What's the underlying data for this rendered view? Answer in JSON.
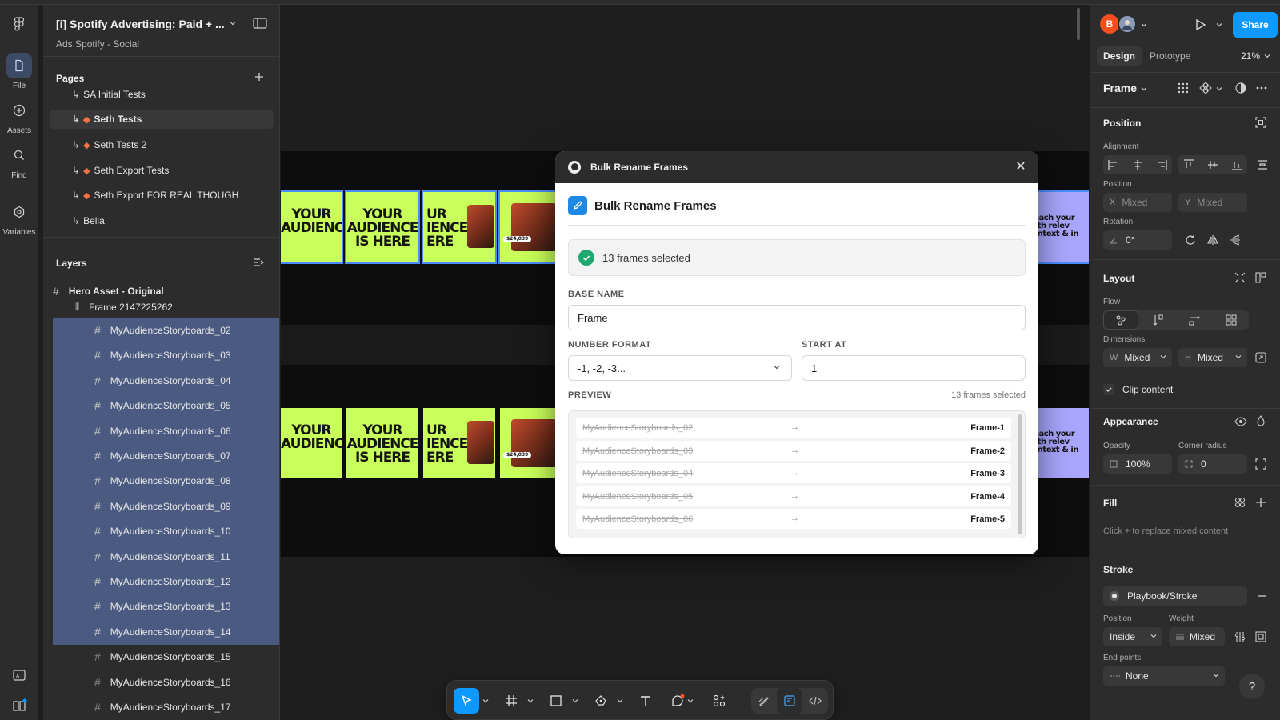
{
  "left_rail": {
    "items": [
      {
        "label": "File",
        "icon": "file-icon"
      },
      {
        "label": "Assets",
        "icon": "assets-icon"
      },
      {
        "label": "Find",
        "icon": "search-icon"
      },
      {
        "label": "Variables",
        "icon": "variables-icon"
      }
    ]
  },
  "file": {
    "title": "[i] Spotify Advertising: Paid + ...",
    "subtitle": "Ads.Spotify - Social"
  },
  "pages": {
    "header": "Pages",
    "items": [
      {
        "label": "SA Initial Tests",
        "emoji": false
      },
      {
        "label": "Seth Tests",
        "emoji": true,
        "selected": true
      },
      {
        "label": "Seth Tests 2",
        "emoji": true
      },
      {
        "label": "Seth Export Tests",
        "emoji": true
      },
      {
        "label": "Seth Export FOR REAL THOUGH",
        "emoji": true
      },
      {
        "label": "Bella",
        "emoji": false
      }
    ]
  },
  "layers": {
    "header": "Layers",
    "root": "Hero Asset - Original",
    "frame": "Frame 2147225262",
    "items": [
      {
        "label": "MyAudienceStoryboards_02",
        "selected": true
      },
      {
        "label": "MyAudienceStoryboards_03",
        "selected": true
      },
      {
        "label": "MyAudienceStoryboards_04",
        "selected": true
      },
      {
        "label": "MyAudienceStoryboards_05",
        "selected": true
      },
      {
        "label": "MyAudienceStoryboards_06",
        "selected": true
      },
      {
        "label": "MyAudienceStoryboards_07",
        "selected": true
      },
      {
        "label": "MyAudienceStoryboards_08",
        "selected": true
      },
      {
        "label": "MyAudienceStoryboards_09",
        "selected": true
      },
      {
        "label": "MyAudienceStoryboards_10",
        "selected": true
      },
      {
        "label": "MyAudienceStoryboards_11",
        "selected": true
      },
      {
        "label": "MyAudienceStoryboards_12",
        "selected": true
      },
      {
        "label": "MyAudienceStoryboards_13",
        "selected": true
      },
      {
        "label": "MyAudienceStoryboards_14",
        "selected": true
      },
      {
        "label": "MyAudienceStoryboards_15",
        "selected": false
      },
      {
        "label": "MyAudienceStoryboards_16",
        "selected": false
      },
      {
        "label": "MyAudienceStoryboards_17",
        "selected": false
      }
    ]
  },
  "canvas": {
    "tiles": {
      "t1": "YOUR\nAUDIENCE",
      "t2": "YOUR\nAUDIENCE\nIS HERE",
      "t3": "UR\nIENCE\nERE",
      "t4": "Reach your\nwith relev\ncontext & in",
      "badge": "$24,839"
    }
  },
  "modal": {
    "bar_title": "Bulk Rename Frames",
    "heading": "Bulk Rename Frames",
    "selected_text": "13 frames selected",
    "base_name_label": "BASE NAME",
    "base_name_value": "Frame",
    "number_format_label": "NUMBER FORMAT",
    "number_format_value": "-1, -2, -3...",
    "start_at_label": "START AT",
    "start_at_value": "1",
    "preview_label": "PREVIEW",
    "preview_count": "13 frames selected",
    "preview_rows": [
      {
        "old": "MyAudienceStoryboards_02",
        "new": "Frame-1"
      },
      {
        "old": "MyAudienceStoryboards_03",
        "new": "Frame-2"
      },
      {
        "old": "MyAudienceStoryboards_04",
        "new": "Frame-3"
      },
      {
        "old": "MyAudienceStoryboards_05",
        "new": "Frame-4"
      },
      {
        "old": "MyAudienceStoryboards_06",
        "new": "Frame-5"
      }
    ],
    "arrow": "→"
  },
  "right_panel": {
    "avatar_letter": "B",
    "share": "Share",
    "tabs": [
      "Design",
      "Prototype"
    ],
    "zoom": "21%",
    "frame_label": "Frame",
    "position_header": "Position",
    "alignment_label": "Alignment",
    "position_label": "Position",
    "x_prefix": "X",
    "x_value": "Mixed",
    "y_prefix": "Y",
    "y_value": "Mixed",
    "rotation_label": "Rotation",
    "rotation_value": "0°",
    "layout_header": "Layout",
    "flow_label": "Flow",
    "dimensions_label": "Dimensions",
    "w_prefix": "W",
    "w_value": "Mixed",
    "h_prefix": "H",
    "h_value": "Mixed",
    "clip_content": "Clip content",
    "appearance_header": "Appearance",
    "opacity_label": "Opacity",
    "opacity_value": "100%",
    "corner_label": "Corner radius",
    "corner_value": "0",
    "fill_header": "Fill",
    "fill_hint": "Click + to replace mixed content",
    "stroke_header": "Stroke",
    "stroke_style": "Playbook/Stroke",
    "stroke_position_label": "Position",
    "stroke_position_value": "Inside",
    "weight_label": "Weight",
    "weight_value": "Mixed",
    "endpoints_label": "End points",
    "endpoints_value": "None",
    "help": "?"
  },
  "colors": {
    "accent": "#0d99ff",
    "selection": "#4a5a80",
    "lime": "#c8ff5a",
    "lavender": "#a9a6ff",
    "success": "#1fa971"
  }
}
